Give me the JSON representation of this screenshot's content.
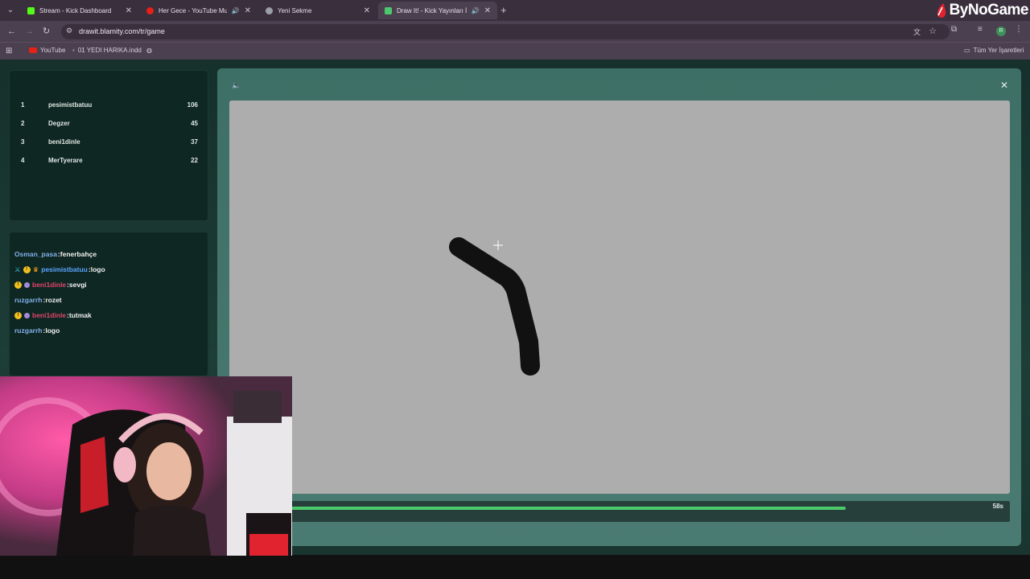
{
  "browser": {
    "tabs": [
      {
        "label": "Stream - Kick Dashboard",
        "icon": "kick-icon",
        "color": "#53fc18"
      },
      {
        "label": "Her Gece - YouTube Music",
        "icon": "youtube-music-icon",
        "color": "#e62117"
      },
      {
        "label": "Yeni Sekme",
        "icon": "chrome-icon",
        "color": "#9aa0a6"
      },
      {
        "label": "Draw It! - Kick Yayınları İçin",
        "icon": "drawit-icon",
        "color": "#4cc96b"
      }
    ],
    "brand": "ByNoGame",
    "url": "drawit.blamity.com/tr/game",
    "bookmarks": {
      "youtube": "YouTube",
      "file": "01 YEDI HARIKA.indd",
      "all": "Tüm Yer İşaretleri"
    }
  },
  "leaderboard": [
    {
      "rank": "1",
      "name": "pesimistbatuu",
      "points": "106"
    },
    {
      "rank": "2",
      "name": "Degzer",
      "points": "45"
    },
    {
      "rank": "3",
      "name": "beni1dinle",
      "points": "37"
    },
    {
      "rank": "4",
      "name": "MerTyerare",
      "points": "22"
    }
  ],
  "chat": [
    {
      "user": "Osman_pasa",
      "text": "fenerbahçe",
      "color": "#7fb0e8",
      "badges": []
    },
    {
      "user": "pesimistbatuu",
      "text": "logo",
      "color": "#5aa4ff",
      "badges": [
        "#3ad0e8",
        "#f2c01e",
        "#f2a01e"
      ]
    },
    {
      "user": "beni1dinle",
      "text": "sevgi",
      "color": "#e0446a",
      "badges": [
        "#f2c01e",
        "#a58ad8"
      ]
    },
    {
      "user": "ruzgarrh",
      "text": "rozet",
      "color": "#7fb0e8",
      "badges": []
    },
    {
      "user": "beni1dinle",
      "text": "tutmak",
      "color": "#e0446a",
      "badges": [
        "#f2c01e",
        "#a58ad8"
      ]
    },
    {
      "user": "ruzgarrh",
      "text": "logo",
      "color": "#7fb0e8",
      "badges": []
    }
  ],
  "timer": {
    "label": "58s",
    "progress": 0.84
  },
  "colors": {
    "accent": "#4cc96b",
    "canvas": "#adadad",
    "stroke": "#111111"
  }
}
